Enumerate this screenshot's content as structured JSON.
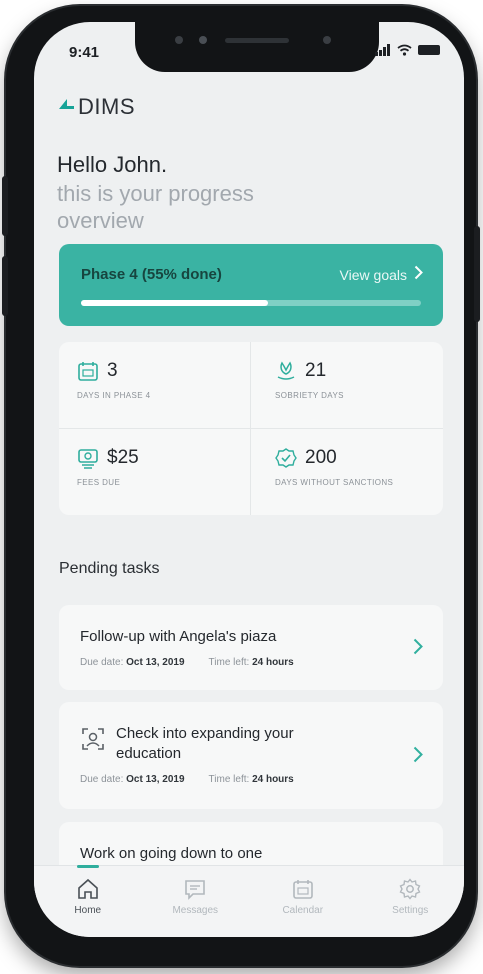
{
  "status": {
    "time": "9:41"
  },
  "app": {
    "logo_text": "DIMS"
  },
  "greeting": {
    "hello": "Hello John.",
    "subtitle": "this is your progress overview"
  },
  "phase": {
    "title": "Phase 4 (55% done)",
    "link_label": "View goals",
    "progress_fraction": 0.55,
    "accent_color": "#3ab3a3"
  },
  "stats": [
    {
      "value": "3",
      "label": "DAYS IN PHASE 4",
      "icon": "calendar-icon"
    },
    {
      "value": "21",
      "label": "SOBRIETY DAYS",
      "icon": "lotus-icon"
    },
    {
      "value": "$25",
      "label": "FEES DUE",
      "icon": "fees-icon"
    },
    {
      "value": "200",
      "label": "DAYS WITHOUT SANCTIONS",
      "icon": "shield-check-icon"
    }
  ],
  "pending": {
    "title": "Pending tasks",
    "tasks": [
      {
        "title": "Follow-up with Angela's piaza",
        "due_label": "Due date:",
        "due": "Oct 13, 2019",
        "left_label": "Time left:",
        "left": "24 hours"
      },
      {
        "title": "Check into expanding your education",
        "due_label": "Due date:",
        "due": "Oct 13, 2019",
        "left_label": "Time left:",
        "left": "24 hours",
        "icon": "face-scan-icon"
      },
      {
        "title": "Work on going down to one"
      }
    ]
  },
  "tabbar": {
    "tabs": [
      {
        "label": "Home",
        "icon": "home-icon"
      },
      {
        "label": "Messages",
        "icon": "messages-icon"
      },
      {
        "label": "Calendar",
        "icon": "calendar-icon"
      },
      {
        "label": "Settings",
        "icon": "gear-icon"
      }
    ]
  }
}
